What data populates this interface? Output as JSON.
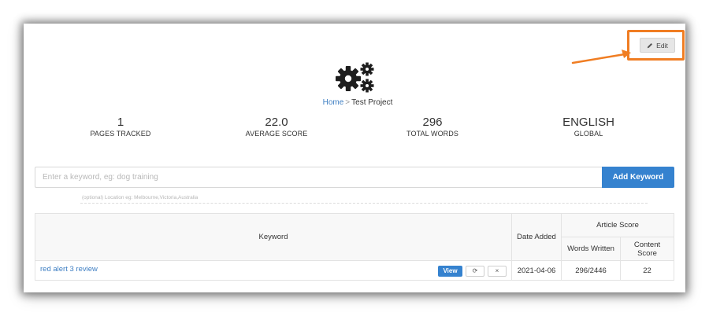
{
  "header": {
    "edit_label": "Edit"
  },
  "breadcrumb": {
    "home": "Home",
    "separator": ">",
    "current": "Test Project"
  },
  "stats": [
    {
      "value": "1",
      "label": "PAGES TRACKED"
    },
    {
      "value": "22.0",
      "label": "AVERAGE SCORE"
    },
    {
      "value": "296",
      "label": "TOTAL WORDS"
    },
    {
      "value": "ENGLISH",
      "label": "GLOBAL"
    }
  ],
  "keyword_form": {
    "keyword_placeholder": "Enter a keyword, eg: dog training",
    "location_placeholder": "(optional) Location eg: Melbourne,Victoria,Australia",
    "add_label": "Add Keyword"
  },
  "table": {
    "headers": {
      "keyword": "Keyword",
      "date_added": "Date Added",
      "article_score": "Article Score",
      "words_written": "Words Written",
      "content_score": "Content Score"
    },
    "rows": [
      {
        "keyword": "red alert 3 review",
        "view_label": "View",
        "refresh_glyph": "⟳",
        "delete_glyph": "×",
        "date_added": "2021-04-06",
        "words_written": "296/2446",
        "content_score": "22"
      }
    ]
  },
  "colors": {
    "accent": "#3582cf",
    "link": "#3f7fc3",
    "highlight": "#f07d22"
  },
  "icons": {
    "edit": "pencil-icon",
    "project": "gears-icon",
    "refresh": "refresh-icon",
    "delete": "close-icon"
  }
}
